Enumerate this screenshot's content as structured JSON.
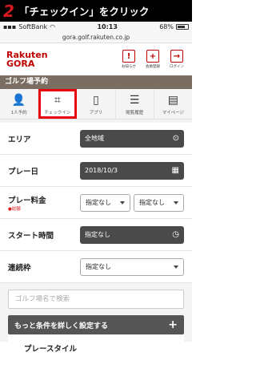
{
  "banner": {
    "step": "2",
    "text": "「チェックイン」をクリック"
  },
  "status": {
    "carrier": "SoftBank",
    "time": "10:13",
    "battery": "68%"
  },
  "url": "gora.golf.rakuten.co.jp",
  "logo": {
    "line1": "Rakuten",
    "line2": "GORA"
  },
  "header_icons": [
    {
      "label": "お知らせ",
      "icon": "notice-icon"
    },
    {
      "label": "会員登録",
      "icon": "member-icon"
    },
    {
      "label": "ログイン",
      "icon": "login-icon"
    }
  ],
  "golf_bar": "ゴルフ場予約",
  "tabs": [
    {
      "label": "1人予約",
      "icon": "person-icon"
    },
    {
      "label": "チェックイン",
      "icon": "qr-scan-icon"
    },
    {
      "label": "アプリ",
      "icon": "phone-icon"
    },
    {
      "label": "閲覧履歴",
      "icon": "history-icon"
    },
    {
      "label": "マイページ",
      "icon": "mypage-icon"
    }
  ],
  "form": {
    "area": {
      "label": "エリア",
      "value": "全地域"
    },
    "play_date": {
      "label": "プレー日",
      "value": "2018/10/3"
    },
    "price": {
      "label": "プレー料金",
      "note": "●総額",
      "min": "指定なし",
      "max": "指定なし"
    },
    "start": {
      "label": "スタート時間",
      "value": "指定なし"
    },
    "consecutive": {
      "label": "連続枠",
      "value": "指定なし"
    },
    "search_placeholder": "ゴルフ場名で検索",
    "more": "もっと条件を詳しく設定する",
    "play_style": "プレースタイル"
  }
}
